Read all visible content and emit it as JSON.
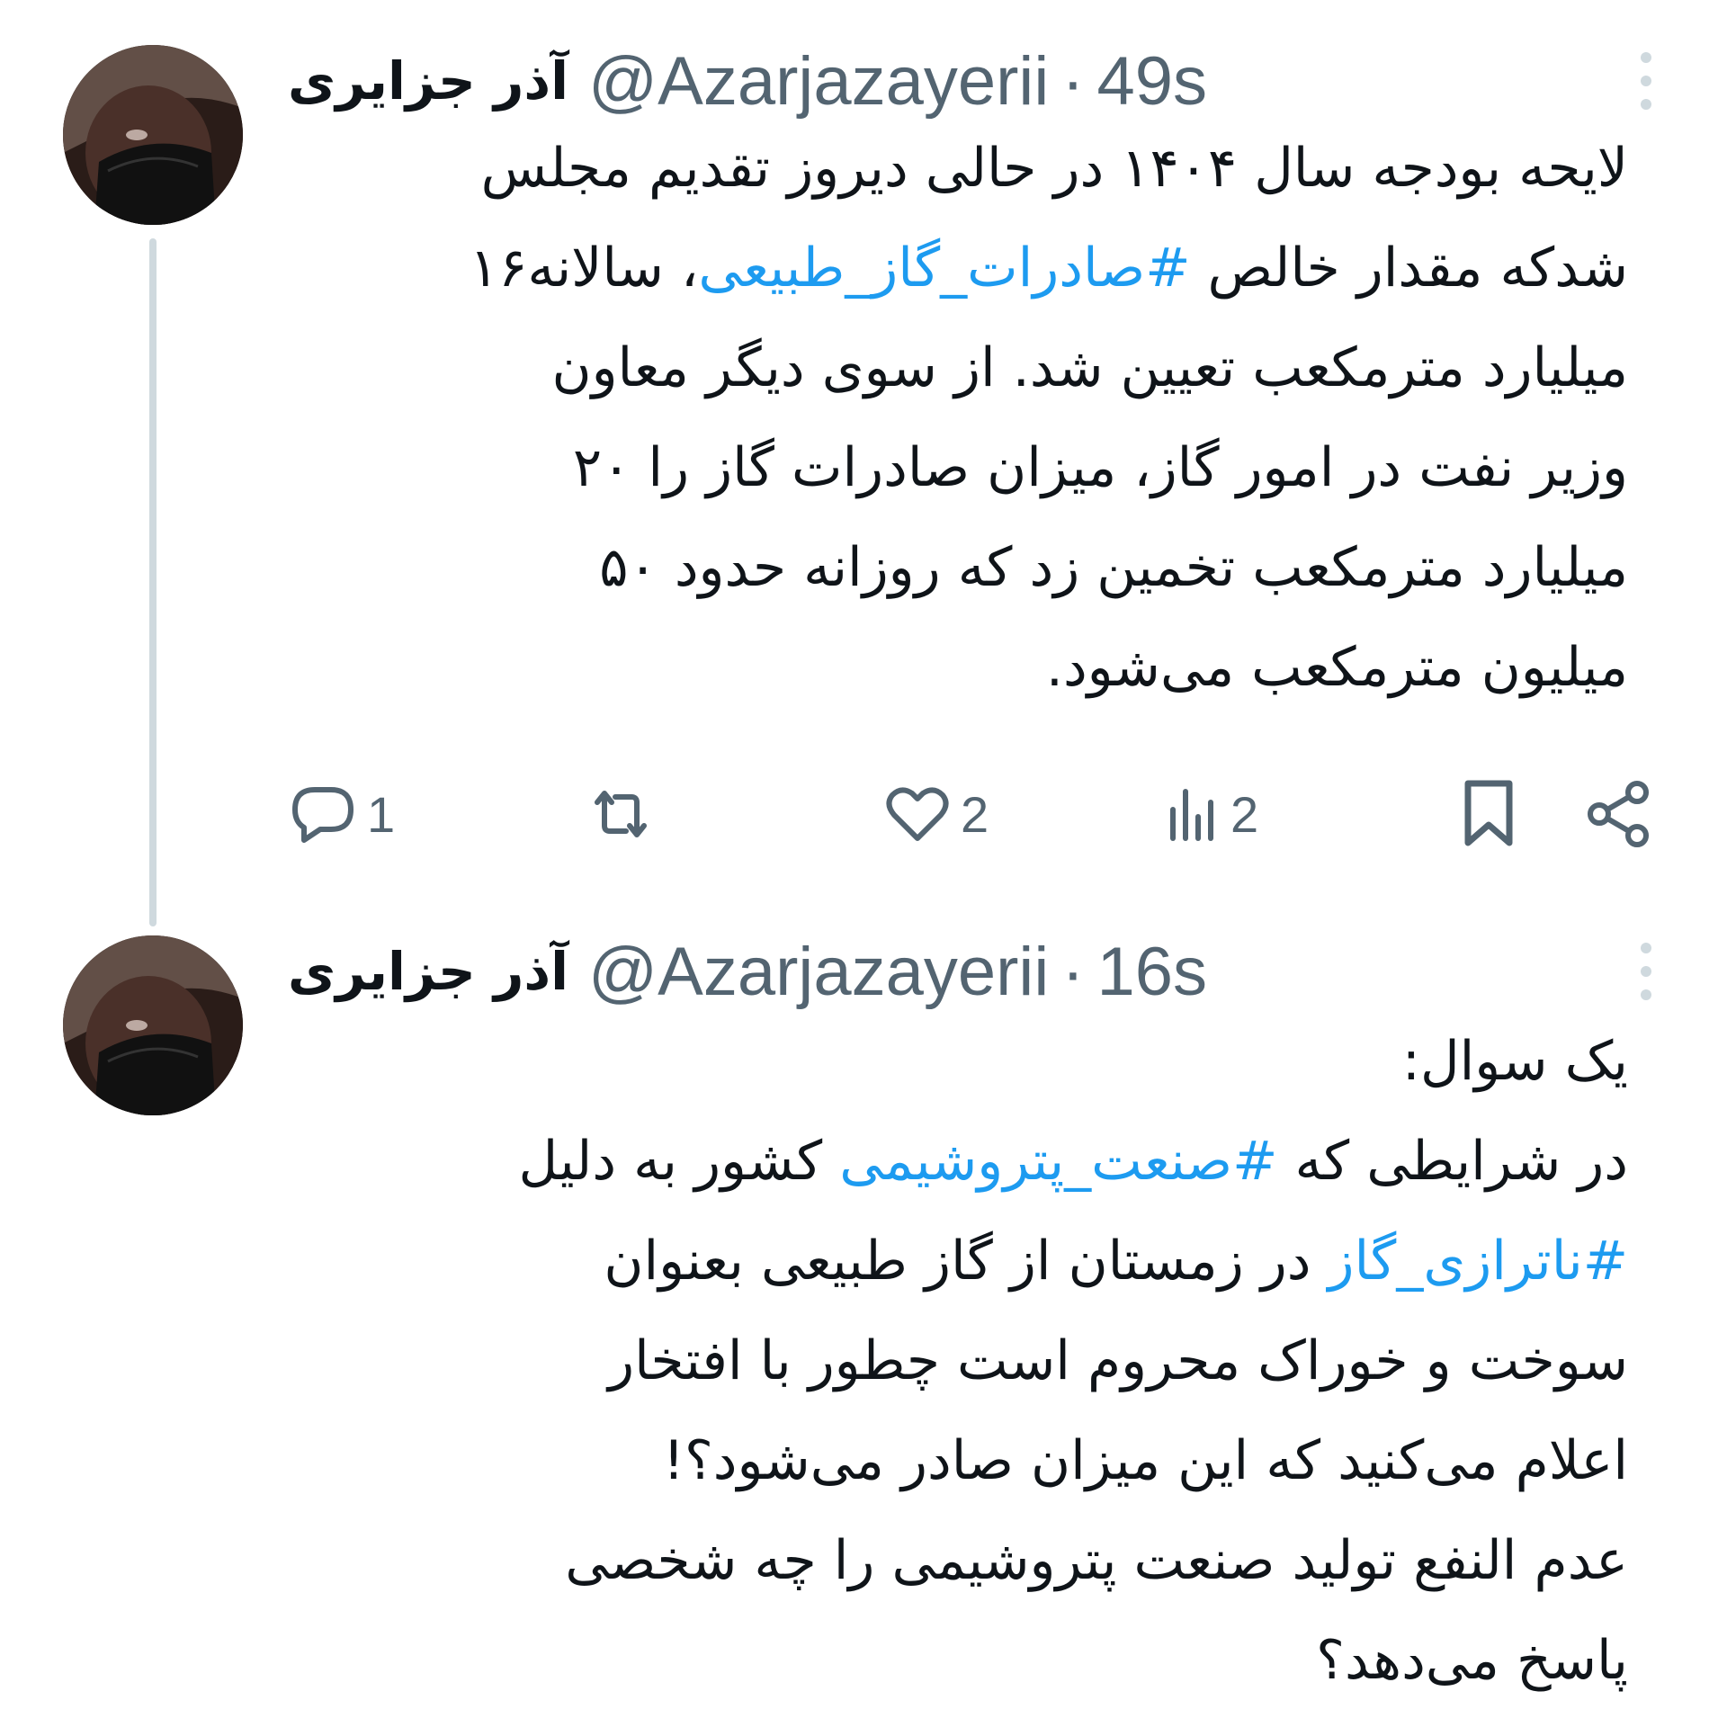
{
  "colors": {
    "text": "#0f1419",
    "secondary": "#536471",
    "hashtag": "#1d9bf0",
    "thread_line": "#cfd9de"
  },
  "tweets": [
    {
      "display_name": "آذر جزایری",
      "handle": "@Azarjazayerii",
      "separator": "·",
      "time": "49s",
      "lines": [
        [
          {
            "text": "لایحه بودجه سال ۱۴۰۴ در حالی دیروز تقدیم مجلس"
          }
        ],
        [
          {
            "text": "شدکه مقدار خالص "
          },
          {
            "text": "#صادرات_گاز_طبیعی",
            "hashtag": true
          },
          {
            "text": "، سالانه۱۶"
          }
        ],
        [
          {
            "text": "میلیارد مترمکعب تعیین شد. از سوی دیگر معاون"
          }
        ],
        [
          {
            "text": "وزیر نفت در امور گاز، میزان صادرات گاز را ۲۰"
          }
        ],
        [
          {
            "text": "میلیارد مترمکعب تخمین زد که روزانه حدود ۵۰"
          }
        ],
        [
          {
            "text": "میلیون مترمکعب می‌شود."
          }
        ]
      ],
      "actions": {
        "reply_icon": "reply-icon",
        "reply_count": "1",
        "retweet_icon": "retweet-icon",
        "retweet_count": "",
        "like_icon": "heart-icon",
        "like_count": "2",
        "views_icon": "views-icon",
        "views_count": "2",
        "bookmark_icon": "bookmark-icon",
        "share_icon": "share-icon"
      }
    },
    {
      "display_name": "آذر جزایری",
      "handle": "@Azarjazayerii",
      "separator": "·",
      "time": "16s",
      "lines": [
        [
          {
            "text": "یک سوال:"
          }
        ],
        [
          {
            "text": "در شرایطی که "
          },
          {
            "text": "#صنعت_پتروشیمی",
            "hashtag": true
          },
          {
            "text": " کشور به دلیل"
          }
        ],
        [
          {
            "text": "#ناترازی_گاز",
            "hashtag": true
          },
          {
            "text": " در زمستان از گاز طبیعی بعنوان"
          }
        ],
        [
          {
            "text": "سوخت و خوراک محروم است چطور با افتخار"
          }
        ],
        [
          {
            "text": "اعلام می‌کنید که این میزان صادر می‌شود؟!"
          }
        ],
        [
          {
            "text": "عدم النفع تولید  صنعت پتروشیمی را چه شخصی"
          }
        ],
        [
          {
            "text": "پاسخ می‌دهد؟"
          }
        ]
      ]
    }
  ]
}
